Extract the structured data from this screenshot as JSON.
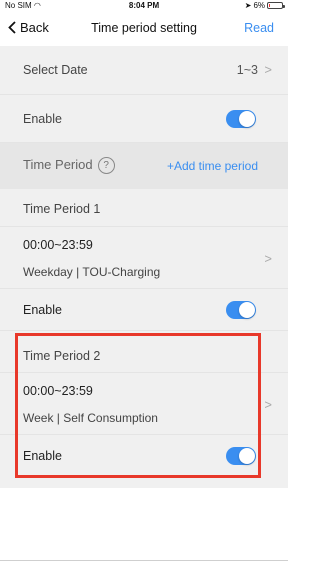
{
  "status_bar": {
    "carrier": "No SIM",
    "time": "8:04 PM",
    "battery": "6%"
  },
  "nav": {
    "back_label": "Back",
    "title": "Time period setting",
    "read_label": "Read"
  },
  "select_date": {
    "label": "Select Date",
    "value": "1~3"
  },
  "enable_main": {
    "label": "Enable",
    "on": true
  },
  "time_period_header": {
    "label": "Time Period",
    "help_icon": "?",
    "add_label": "+Add time period"
  },
  "periods": [
    {
      "title": "Time Period 1",
      "time_range": "00:00~23:59",
      "mode": "Weekday | TOU-Charging",
      "enable_label": "Enable",
      "enabled": true
    },
    {
      "title": "Time Period 2",
      "time_range": "00:00~23:59",
      "mode": "Week | Self Consumption",
      "enable_label": "Enable",
      "enabled": true
    }
  ],
  "colors": {
    "accent": "#3a8ef0",
    "highlight": "#e8382a",
    "background": "#f0f0f0"
  }
}
